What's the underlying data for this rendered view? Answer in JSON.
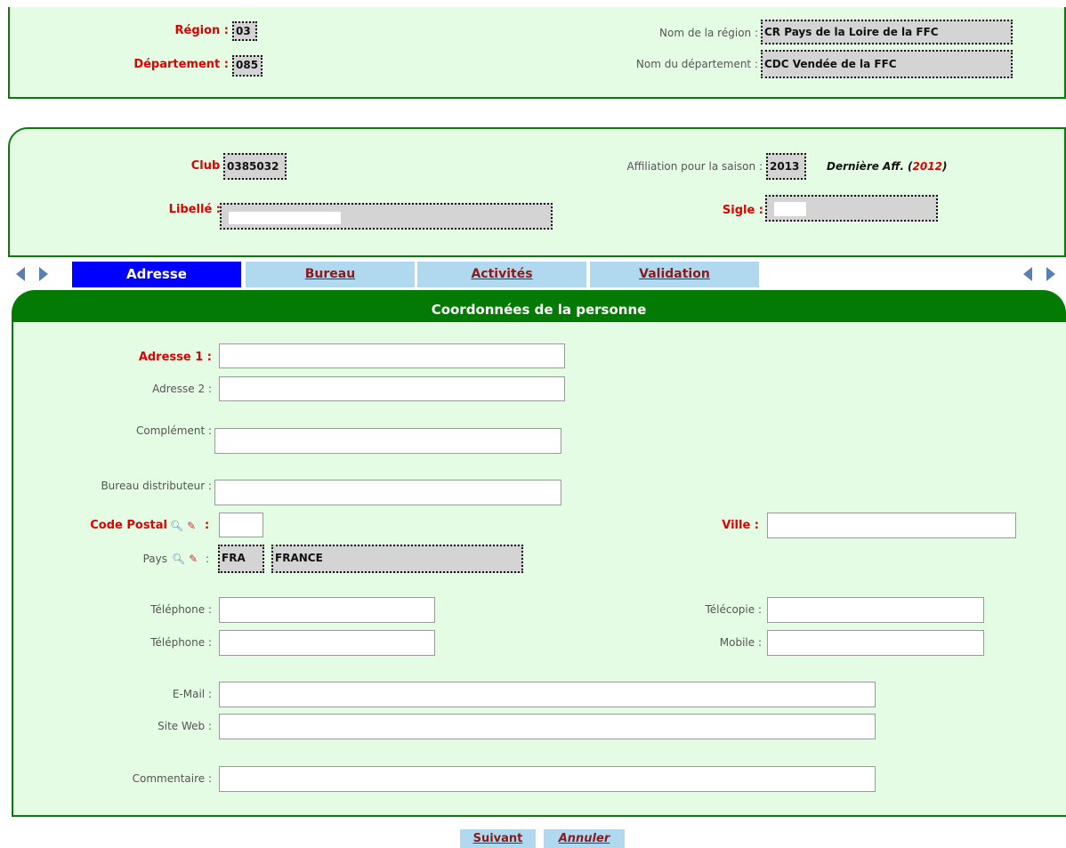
{
  "header": {
    "region_label": "Région :",
    "region_code": "03",
    "department_label": "Département :",
    "department_code": "085",
    "region_name_label": "Nom de la région :",
    "region_name": "CR Pays de la Loire de la FFC",
    "department_name_label": "Nom du département :",
    "department_name": "CDC Vendée de la FFC"
  },
  "club": {
    "club_label": "Club :",
    "club_code": "0385032",
    "affiliation_label": "Affiliation pour la saison :",
    "affiliation_season": "2013",
    "last_aff_label": "Dernière Aff. (",
    "last_aff_year": "2012",
    "last_aff_close": ")",
    "libelle_label": "Libellé :",
    "sigle_label": "Sigle :"
  },
  "tabs": [
    {
      "label": "Adresse"
    },
    {
      "label": "Bureau"
    },
    {
      "label": "Activités"
    },
    {
      "label": "Validation"
    }
  ],
  "section_title": "Coordonnées de la personne",
  "form": {
    "adresse1_label": "Adresse 1 :",
    "adresse2_label": "Adresse 2 :",
    "complement_label": "Complément :",
    "bureau_label": "Bureau distributeur :",
    "code_postal_label": "Code Postal",
    "code_postal_colon": ":",
    "ville_label": "Ville :",
    "pays_label": "Pays",
    "pays_colon": ":",
    "pays_code": "FRA",
    "pays_name": "FRANCE",
    "telephone1_label": "Téléphone :",
    "telecopie_label": "Télécopie :",
    "telephone2_label": "Téléphone :",
    "mobile_label": "Mobile :",
    "email_label": "E-Mail :",
    "siteweb_label": "Site Web :",
    "commentaire_label": "Commentaire :"
  },
  "icons": {
    "search": "magnifier-icon",
    "clear": "eraser-icon",
    "prev": "arrow-left-icon",
    "next": "arrow-right-icon"
  },
  "buttons": {
    "next": "Suivant",
    "cancel": "Annuler"
  }
}
